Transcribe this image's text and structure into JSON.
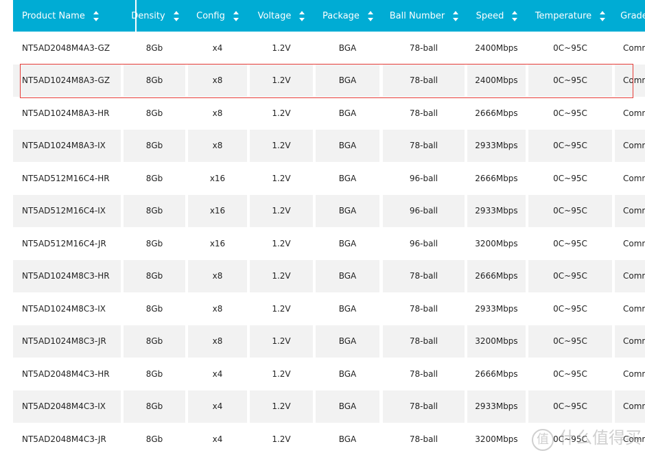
{
  "table": {
    "columns": [
      "Product Name",
      "Density",
      "Config",
      "Voltage",
      "Package",
      "Ball Number",
      "Speed",
      "Temperature",
      "Grade"
    ],
    "rows": [
      [
        "NT5AD2048M4A3-GZ",
        "8Gb",
        "x4",
        "1.2V",
        "BGA",
        "78-ball",
        "2400Mbps",
        "0C~95C",
        "Commercial"
      ],
      [
        "NT5AD1024M8A3-GZ",
        "8Gb",
        "x8",
        "1.2V",
        "BGA",
        "78-ball",
        "2400Mbps",
        "0C~95C",
        "Commercial"
      ],
      [
        "NT5AD1024M8A3-HR",
        "8Gb",
        "x8",
        "1.2V",
        "BGA",
        "78-ball",
        "2666Mbps",
        "0C~95C",
        "Commercial"
      ],
      [
        "NT5AD1024M8A3-IX",
        "8Gb",
        "x8",
        "1.2V",
        "BGA",
        "78-ball",
        "2933Mbps",
        "0C~95C",
        "Commercial"
      ],
      [
        "NT5AD512M16C4-HR",
        "8Gb",
        "x16",
        "1.2V",
        "BGA",
        "96-ball",
        "2666Mbps",
        "0C~95C",
        "Commercial"
      ],
      [
        "NT5AD512M16C4-IX",
        "8Gb",
        "x16",
        "1.2V",
        "BGA",
        "96-ball",
        "2933Mbps",
        "0C~95C",
        "Commercial"
      ],
      [
        "NT5AD512M16C4-JR",
        "8Gb",
        "x16",
        "1.2V",
        "BGA",
        "96-ball",
        "3200Mbps",
        "0C~95C",
        "Commercial"
      ],
      [
        "NT5AD1024M8C3-HR",
        "8Gb",
        "x8",
        "1.2V",
        "BGA",
        "78-ball",
        "2666Mbps",
        "0C~95C",
        "Commercial"
      ],
      [
        "NT5AD1024M8C3-IX",
        "8Gb",
        "x8",
        "1.2V",
        "BGA",
        "78-ball",
        "2933Mbps",
        "0C~95C",
        "Commercial"
      ],
      [
        "NT5AD1024M8C3-JR",
        "8Gb",
        "x8",
        "1.2V",
        "BGA",
        "78-ball",
        "3200Mbps",
        "0C~95C",
        "Commercial"
      ],
      [
        "NT5AD2048M4C3-HR",
        "8Gb",
        "x4",
        "1.2V",
        "BGA",
        "78-ball",
        "2666Mbps",
        "0C~95C",
        "Commercial"
      ],
      [
        "NT5AD2048M4C3-IX",
        "8Gb",
        "x4",
        "1.2V",
        "BGA",
        "78-ball",
        "2933Mbps",
        "0C~95C",
        "Commercial"
      ],
      [
        "NT5AD2048M4C3-JR",
        "8Gb",
        "x4",
        "1.2V",
        "BGA",
        "78-ball",
        "3200Mbps",
        "0C~95C",
        "Commercial"
      ]
    ],
    "highlighted_row": 1
  },
  "colors": {
    "header": "#00acd4",
    "alt_row": "#f2f2f2",
    "highlight": "#e53935"
  },
  "watermark": {
    "badge": "值",
    "text": "什么值得买"
  }
}
